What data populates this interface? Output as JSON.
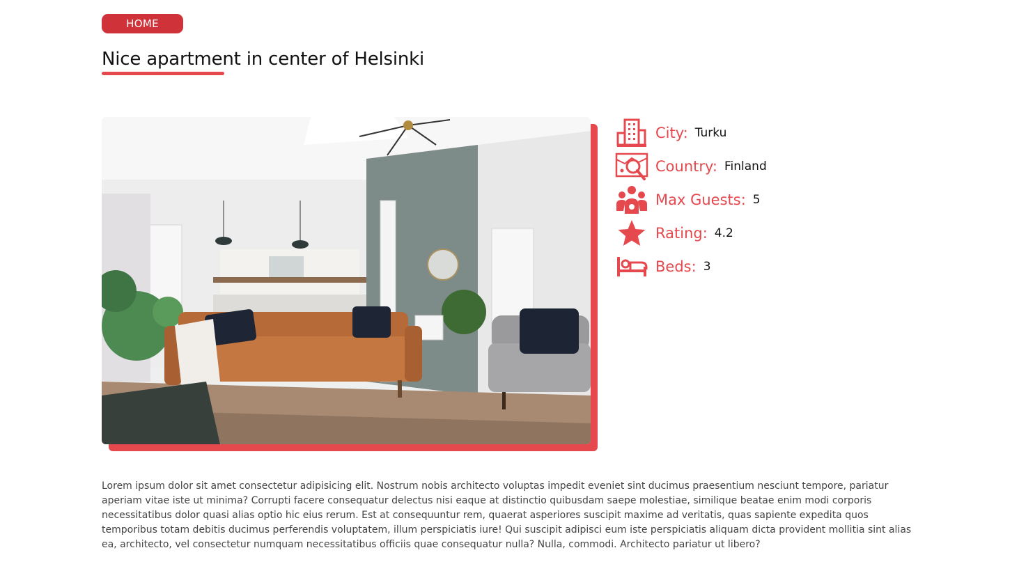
{
  "nav": {
    "home_label": "HOME"
  },
  "listing": {
    "title": "Nice apartment in center of Helsinki",
    "description": "Lorem ipsum dolor sit amet consectetur adipisicing elit. Nostrum nobis architecto voluptas impedit eveniet sint ducimus praesentium nesciunt tempore, pariatur aperiam vitae iste ut minima? Corrupti facere consequatur delectus nisi eaque at distinctio quibusdam saepe molestiae, similique beatae enim modi corporis necessitatibus dolor quasi alias optio hic eius rerum. Est at consequuntur rem, quaerat asperiores suscipit maxime ad veritatis, quas sapiente expedita quos temporibus totam debitis ducimus perferendis voluptatem, illum perspiciatis iure! Qui suscipit adipisci eum iste perspiciatis aliquam dicta provident mollitia sint alias ea, architecto, vel consectetur numquam necessitatibus officiis quae consequatur nulla? Nulla, commodi. Architecto pariatur ut libero?",
    "details": [
      {
        "icon": "building-icon",
        "label": "City:",
        "value": "Turku"
      },
      {
        "icon": "map-search-icon",
        "label": "Country:",
        "value": "Finland"
      },
      {
        "icon": "people-group-icon",
        "label": "Max Guests:",
        "value": "5"
      },
      {
        "icon": "star-icon",
        "label": "Rating:",
        "value": "4.2"
      },
      {
        "icon": "bed-icon",
        "label": "Beds:",
        "value": "3"
      }
    ]
  },
  "colors": {
    "accent": "#e5484d",
    "button": "#cf3239"
  }
}
